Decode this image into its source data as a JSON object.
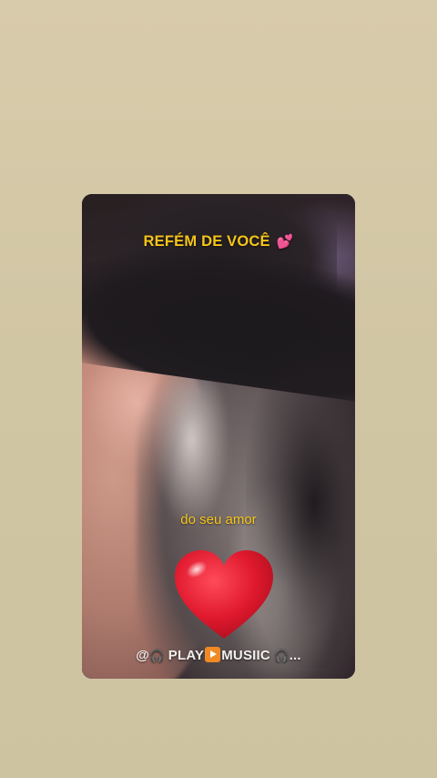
{
  "story": {
    "caption_top": "REFÉM DE VOCÊ",
    "caption_top_emoji": "💕",
    "caption_mid": "do seu amor",
    "watermark": {
      "at": "@",
      "headphones_icon": "🎧",
      "play": "PLAY",
      "music": "MUSIIC",
      "tail_icon": "🎧",
      "ellipsis": "..."
    }
  },
  "colors": {
    "background": "#d3c7a5",
    "caption": "#f5c518",
    "heart": "#e0192e",
    "play_box": "#f08a24"
  }
}
